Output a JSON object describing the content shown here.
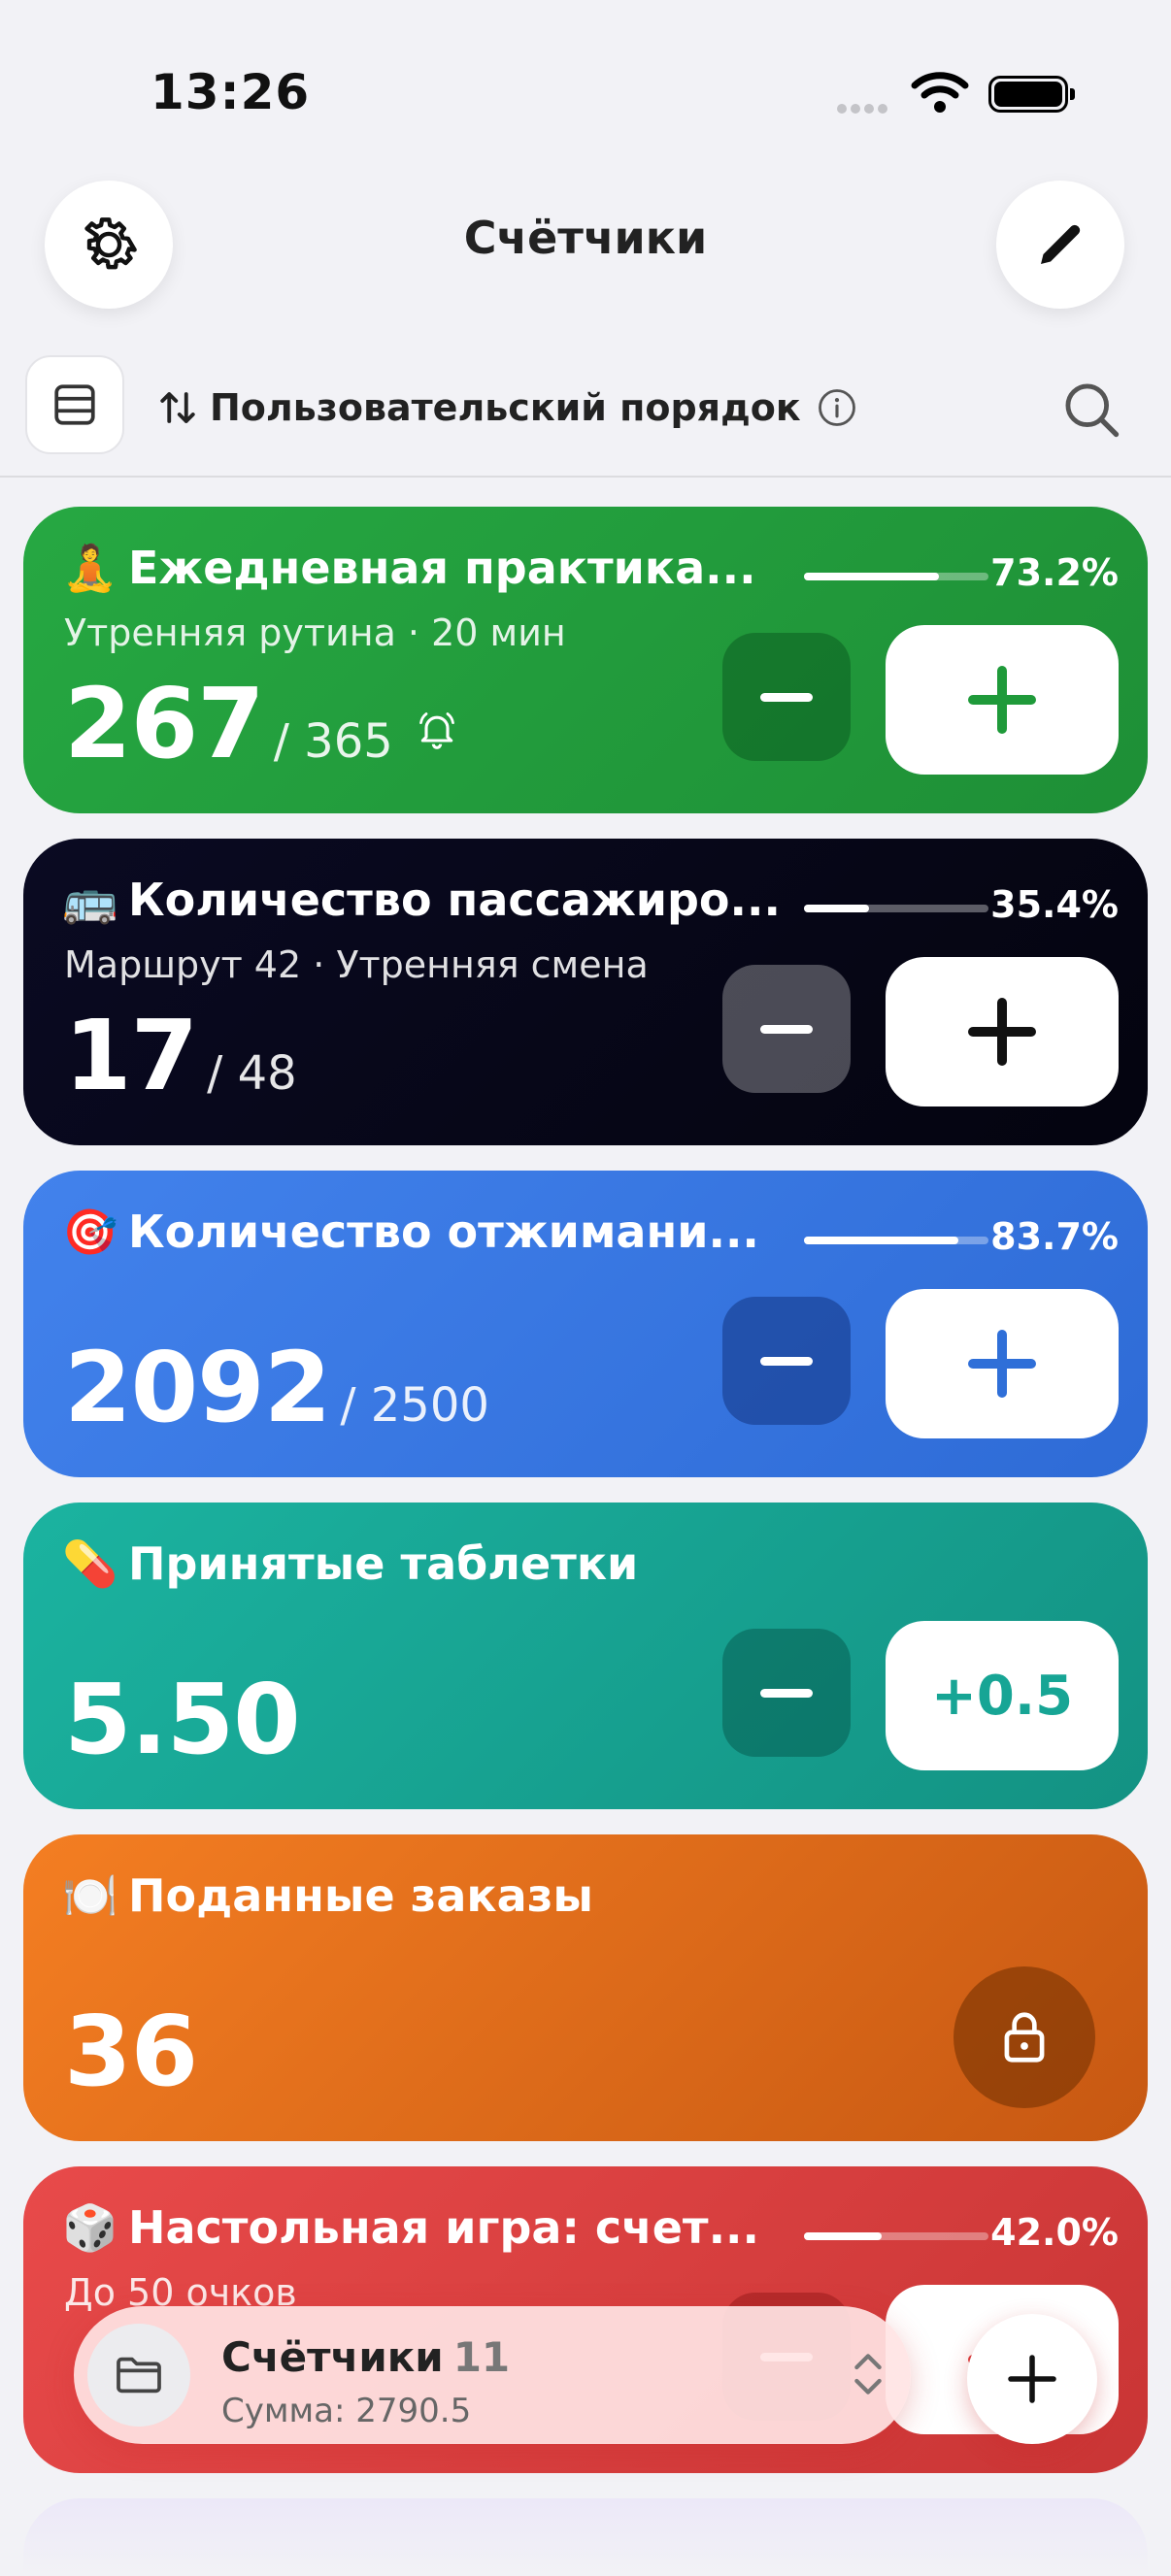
{
  "status_bar": {
    "time": "13:26"
  },
  "nav": {
    "title": "Счётчики"
  },
  "toolbar": {
    "sort_label": "Пользовательский порядок"
  },
  "counters": [
    {
      "emoji": "🧘",
      "title": "Ежедневная практика...",
      "subtitle": "Утренняя рутина · 20 мин",
      "value": "267",
      "goal": "/ 365",
      "progress": 0.732,
      "progress_label": "73.2%",
      "increment": "+",
      "has_reminder": true,
      "color": "#229a3a",
      "accent": "#1f9a3a"
    },
    {
      "emoji": "🚌",
      "title": "Количество пассажиро...",
      "subtitle": "Маршрут 42 · Утренняя смена",
      "value": "17",
      "goal": "/ 48",
      "progress": 0.354,
      "progress_label": "35.4%",
      "increment": "+",
      "color": "#06061a",
      "accent": "#111111"
    },
    {
      "emoji": "🎯",
      "title": "Количество отжимани...",
      "subtitle": "",
      "value": "2092",
      "goal": "/ 2500",
      "progress": 0.837,
      "progress_label": "83.7%",
      "increment": "+",
      "color": "#3b78e0",
      "accent": "#2f6fd8"
    },
    {
      "emoji": "💊",
      "title": "Принятые таблетки",
      "subtitle": "",
      "value": "5.50",
      "goal": "",
      "increment": "+0.5",
      "color": "#17a595",
      "accent": "#17a595"
    },
    {
      "emoji": "🍽️",
      "title": "Поданные заказы",
      "subtitle": "",
      "value": "36",
      "goal": "",
      "locked": true,
      "color": "#ee7a20"
    },
    {
      "emoji": "🎲",
      "title": "Настольная игра: счет...",
      "subtitle": "До 50 очков",
      "value": "",
      "goal": "",
      "progress": 0.42,
      "progress_label": "42.0%",
      "increment": "+",
      "color": "#e14545",
      "accent": "#d93c3c"
    }
  ],
  "bottom_bar": {
    "title": "Счётчики",
    "count": "11",
    "sum": "Сумма: 2790.5"
  },
  "icons": {
    "settings": "gear-icon",
    "edit": "pencil-icon",
    "layout": "list-layout-icon",
    "sort": "sort-arrows-icon",
    "info": "info-icon",
    "search": "search-icon",
    "reminder": "bell-icon",
    "lock": "lock-icon",
    "folder": "folder-icon",
    "switch": "chevron-updown-icon",
    "add": "plus-icon"
  }
}
